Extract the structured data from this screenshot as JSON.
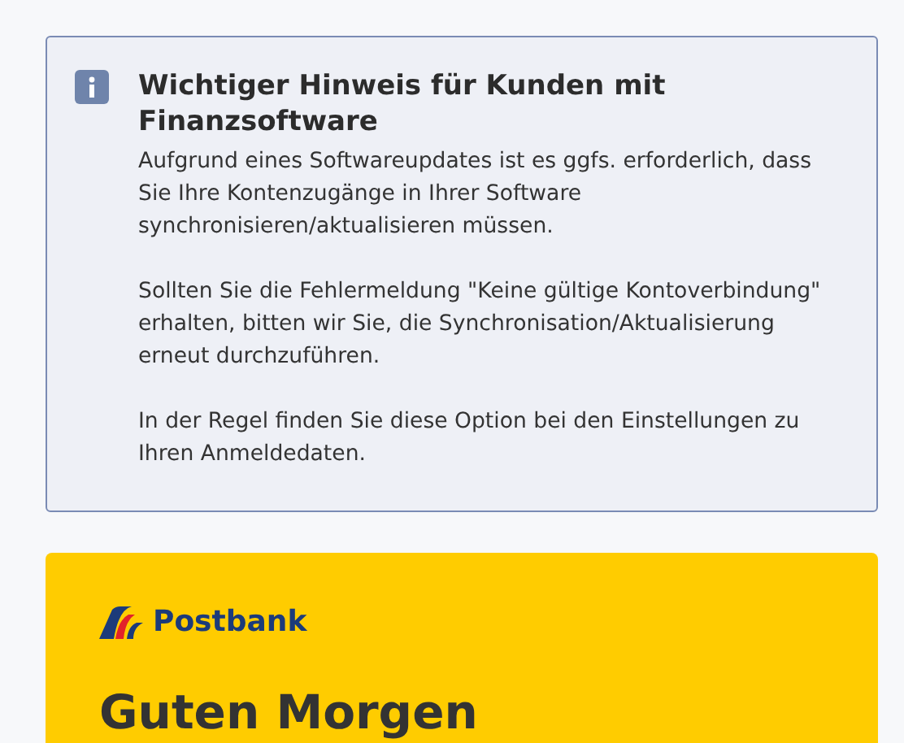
{
  "notice": {
    "title": "Wichtiger Hinweis für Kunden mit Finanzsoftware",
    "paragraphs": [
      "Aufgrund eines Softwareupdates ist es ggfs. erforderlich, dass Sie Ihre Kontenzugänge in Ihrer Software synchronisieren/aktualisieren müssen.",
      "Sollten Sie die Fehlermeldung \"Keine gültige Kontoverbindung\" erhalten, bitten wir Sie, die Synchronisation/Aktualisierung erneut durchzuführen.",
      "In der Regel finden Sie diese Option bei den Einstellungen zu Ihren Anmeldedaten."
    ]
  },
  "login_card": {
    "brand": "Postbank",
    "greeting": "Guten Morgen"
  }
}
